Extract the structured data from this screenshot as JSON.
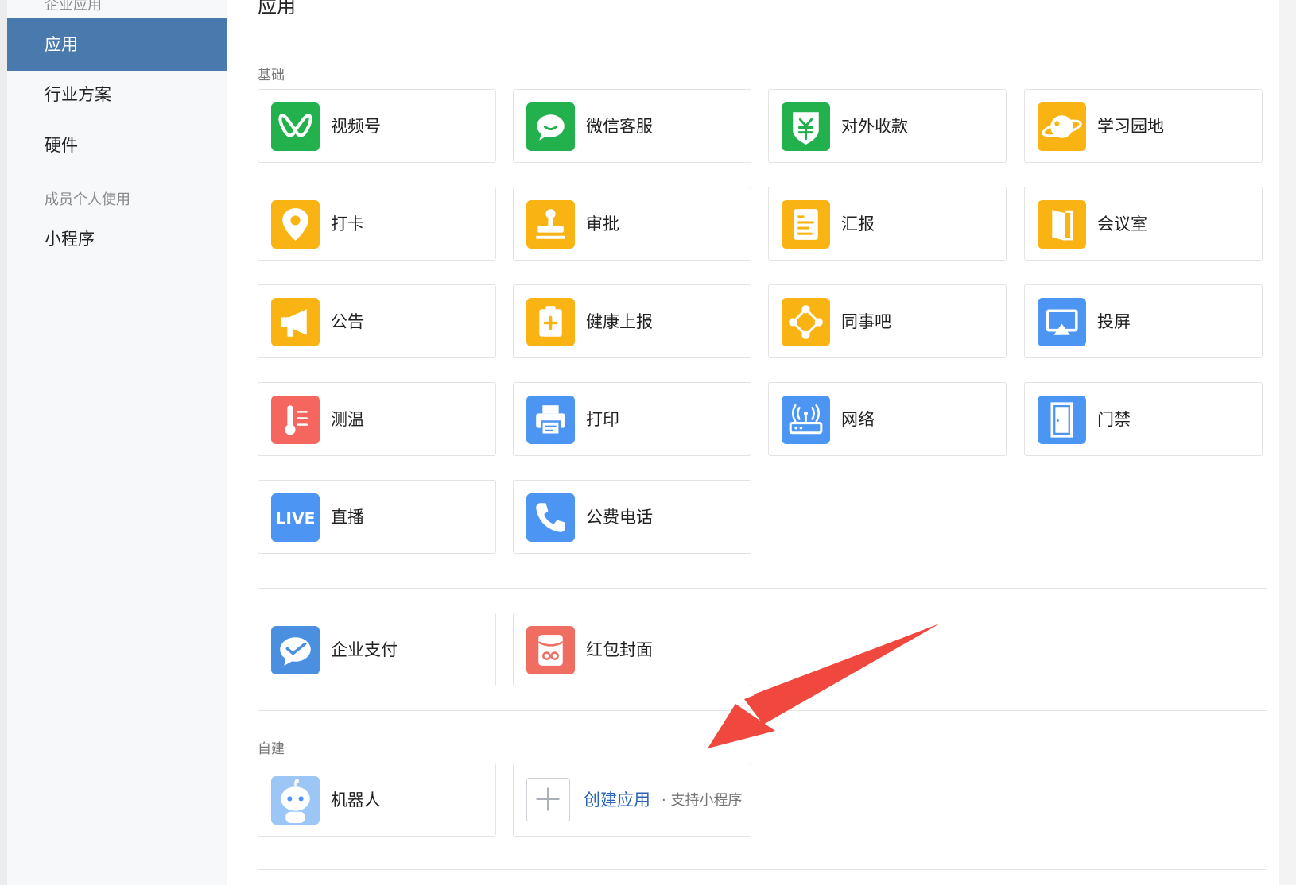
{
  "sidebar": {
    "group_top": "企业应用",
    "items": [
      {
        "label": "应用",
        "active": true
      },
      {
        "label": "行业方案"
      },
      {
        "label": "硬件"
      }
    ],
    "group_member": "成员个人使用",
    "items2": [
      {
        "label": "小程序"
      }
    ]
  },
  "main": {
    "title": "应用",
    "section_basic": "基础",
    "section_custom": "自建",
    "basic_apps": [
      {
        "label": "视频号",
        "icon": "channels-icon"
      },
      {
        "label": "微信客服",
        "icon": "chat-bubble-icon"
      },
      {
        "label": "对外收款",
        "icon": "yuan-shield-icon"
      },
      {
        "label": "学习园地",
        "icon": "planet-icon"
      },
      {
        "label": "打卡",
        "icon": "location-pin-icon"
      },
      {
        "label": "审批",
        "icon": "stamp-icon"
      },
      {
        "label": "汇报",
        "icon": "report-document-icon"
      },
      {
        "label": "会议室",
        "icon": "door-open-icon"
      },
      {
        "label": "公告",
        "icon": "megaphone-icon"
      },
      {
        "label": "健康上报",
        "icon": "clipboard-plus-icon"
      },
      {
        "label": "同事吧",
        "icon": "network-nodes-icon"
      },
      {
        "label": "投屏",
        "icon": "screen-cast-icon"
      },
      {
        "label": "测温",
        "icon": "thermometer-icon"
      },
      {
        "label": "打印",
        "icon": "printer-icon"
      },
      {
        "label": "网络",
        "icon": "router-icon"
      },
      {
        "label": "门禁",
        "icon": "door-icon"
      },
      {
        "label": "直播",
        "icon": "live-icon"
      },
      {
        "label": "公费电话",
        "icon": "phone-icon"
      }
    ],
    "pay_apps": [
      {
        "label": "企业支付",
        "icon": "wechat-pay-icon"
      },
      {
        "label": "红包封面",
        "icon": "red-packet-icon"
      }
    ],
    "custom_apps": [
      {
        "label": "机器人",
        "icon": "robot-icon"
      }
    ],
    "create": {
      "label": "创建应用",
      "sub": "· 支持小程序"
    },
    "live_text": "LIVE"
  },
  "colors": {
    "green": "#23b14d",
    "yellow": "#f9b413",
    "blue": "#4c95f2",
    "red": "#f5665f",
    "sidebar_active": "#4a79ad",
    "link": "#2b63b5",
    "arrow": "#f0483e"
  }
}
